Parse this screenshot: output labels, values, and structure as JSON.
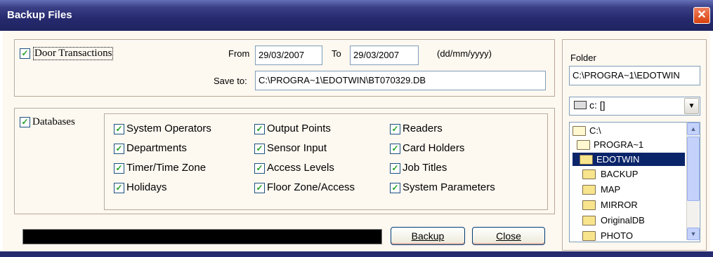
{
  "window": {
    "title": "Backup Files",
    "close_glyph": "✕"
  },
  "door": {
    "checkbox_label": "Door Transactions",
    "checked": true,
    "from_label": "From",
    "from_value": "29/03/2007",
    "to_label": "To",
    "to_value": "29/03/2007",
    "format_hint": "(dd/mm/yyyy)",
    "saveto_label": "Save to:",
    "saveto_value": "C:\\PROGRA~1\\EDOTWIN\\BT070329.DB"
  },
  "databases": {
    "checkbox_label": "Databases",
    "checked": true,
    "items": [
      [
        "System Operators",
        "Output Points",
        "Readers"
      ],
      [
        "Departments",
        "Sensor Input",
        "Card Holders"
      ],
      [
        "Timer/Time Zone",
        "Access Levels",
        "Job Titles"
      ],
      [
        "Holidays",
        "Floor Zone/Access",
        "System Parameters"
      ]
    ]
  },
  "folder": {
    "label": "Folder",
    "path_value": "C:\\PROGRA~1\\EDOTWIN",
    "drive_value": "c: []",
    "tree": [
      "C:\\",
      "PROGRA~1",
      "EDOTWIN",
      "BACKUP",
      "MAP",
      "MIRROR",
      "OriginalDB",
      "PHOTO"
    ],
    "selected": "EDOTWIN"
  },
  "buttons": {
    "backup": "Backup",
    "close": "Close"
  },
  "progress": {
    "value": 1.0
  },
  "colors": {
    "titlebar": "#262a6e",
    "check": "#21a121",
    "selection": "#0a246a",
    "client_bg": "#fdf8f0"
  }
}
